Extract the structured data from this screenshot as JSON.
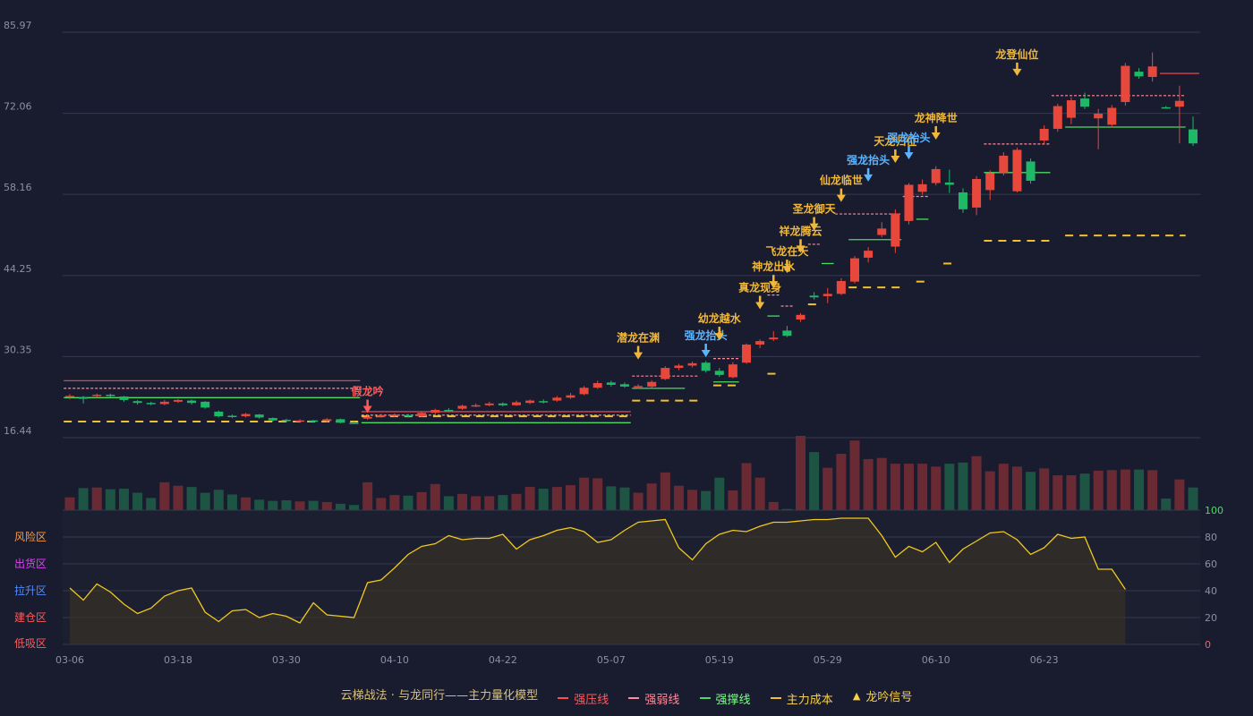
{
  "chart_data": {
    "type": "candlestick",
    "price_axis": {
      "ticks": [
        "85.97",
        "72.06",
        "58.16",
        "44.25",
        "30.35",
        "16.44"
      ],
      "min": 16.44,
      "max": 85.97
    },
    "x_tick_labels": [
      {
        "i": 0,
        "label": "03-06"
      },
      {
        "i": 8,
        "label": "03-18"
      },
      {
        "i": 16,
        "label": "03-30"
      },
      {
        "i": 24,
        "label": "04-10"
      },
      {
        "i": 32,
        "label": "04-22"
      },
      {
        "i": 40,
        "label": "05-07"
      },
      {
        "i": 48,
        "label": "05-19"
      },
      {
        "i": 56,
        "label": "05-29"
      },
      {
        "i": 64,
        "label": "06-10"
      },
      {
        "i": 72,
        "label": "06-23"
      }
    ],
    "candles": [
      [
        23.5,
        23.6,
        23.9,
        23.0
      ],
      [
        23.4,
        23.1,
        23.6,
        22.3
      ],
      [
        23.6,
        23.8,
        24.0,
        23.3
      ],
      [
        23.8,
        23.6,
        24.0,
        23.4
      ],
      [
        23.5,
        22.9,
        23.6,
        22.6
      ],
      [
        22.7,
        22.4,
        22.9,
        22.1
      ],
      [
        22.4,
        22.3,
        22.6,
        22.0
      ],
      [
        22.2,
        22.6,
        22.9,
        22.0
      ],
      [
        22.6,
        22.9,
        23.1,
        22.4
      ],
      [
        22.8,
        22.4,
        23.0,
        22.1
      ],
      [
        22.6,
        21.6,
        22.7,
        21.4
      ],
      [
        20.9,
        20.1,
        21.1,
        19.9
      ],
      [
        20.2,
        20.1,
        20.4,
        19.8
      ],
      [
        20.1,
        20.5,
        20.7,
        19.9
      ],
      [
        20.4,
        19.9,
        20.5,
        19.7
      ],
      [
        19.8,
        19.4,
        19.9,
        19.2
      ],
      [
        19.5,
        19.3,
        19.7,
        19.1
      ],
      [
        19.2,
        19.4,
        19.6,
        19.0
      ],
      [
        19.4,
        19.2,
        19.5,
        19.0
      ],
      [
        19.3,
        19.6,
        19.8,
        19.1
      ],
      [
        19.6,
        19.0,
        19.7,
        18.9
      ],
      [
        19.0,
        18.9,
        19.2,
        18.8
      ],
      [
        19.7,
        20.0,
        20.3,
        19.5
      ],
      [
        20.0,
        20.3,
        20.5,
        19.9
      ],
      [
        20.2,
        20.4,
        20.6,
        20.0
      ],
      [
        20.3,
        20.1,
        20.5,
        19.9
      ],
      [
        20.1,
        20.7,
        20.9,
        20.0
      ],
      [
        20.7,
        21.2,
        21.4,
        20.5
      ],
      [
        21.2,
        21.0,
        21.5,
        20.8
      ],
      [
        21.4,
        21.9,
        22.1,
        21.2
      ],
      [
        21.9,
        22.0,
        22.3,
        21.7
      ],
      [
        22.0,
        22.3,
        22.6,
        21.8
      ],
      [
        22.3,
        22.0,
        22.5,
        21.8
      ],
      [
        22.0,
        22.5,
        22.8,
        21.9
      ],
      [
        22.4,
        22.8,
        23.0,
        22.2
      ],
      [
        22.7,
        22.5,
        23.0,
        22.3
      ],
      [
        22.8,
        23.3,
        23.6,
        22.6
      ],
      [
        23.3,
        23.7,
        24.1,
        23.1
      ],
      [
        23.9,
        25.0,
        25.3,
        23.7
      ],
      [
        25.0,
        25.8,
        26.2,
        24.8
      ],
      [
        25.9,
        25.5,
        26.2,
        25.2
      ],
      [
        25.6,
        25.2,
        25.9,
        25.0
      ],
      [
        25.1,
        25.3,
        25.6,
        24.8
      ],
      [
        25.2,
        26.0,
        26.3,
        25.0
      ],
      [
        26.5,
        28.4,
        28.7,
        26.3
      ],
      [
        28.4,
        28.8,
        29.1,
        28.0
      ],
      [
        28.8,
        29.2,
        29.5,
        28.5
      ],
      [
        29.3,
        27.9,
        29.6,
        27.6
      ],
      [
        27.9,
        27.2,
        28.4,
        26.9
      ],
      [
        26.8,
        29.0,
        29.4,
        26.6
      ],
      [
        29.3,
        32.4,
        32.6,
        29.1
      ],
      [
        32.4,
        33.0,
        33.3,
        31.8
      ],
      [
        33.3,
        33.6,
        34.7,
        33.0
      ],
      [
        34.8,
        33.9,
        35.6,
        33.7
      ],
      [
        36.7,
        37.5,
        37.8,
        36.3
      ],
      [
        40.8,
        40.5,
        41.4,
        40.1
      ],
      [
        40.7,
        41.1,
        42.1,
        39.5
      ],
      [
        41.1,
        43.3,
        43.8,
        40.9
      ],
      [
        43.2,
        47.2,
        47.6,
        42.9
      ],
      [
        47.3,
        48.5,
        49.1,
        46.5
      ],
      [
        51.2,
        52.3,
        53.4,
        50.8
      ],
      [
        49.2,
        54.9,
        55.6,
        48.1
      ],
      [
        53.6,
        59.8,
        60.1,
        53.0
      ],
      [
        58.6,
        59.9,
        60.7,
        58.1
      ],
      [
        60.1,
        62.5,
        63.0,
        59.7
      ],
      [
        60.2,
        59.8,
        62.4,
        58.4
      ],
      [
        58.5,
        55.6,
        59.2,
        55.0
      ],
      [
        55.9,
        60.8,
        61.3,
        54.6
      ],
      [
        58.9,
        61.8,
        62.3,
        57.2
      ],
      [
        61.9,
        64.8,
        65.4,
        61.4
      ],
      [
        58.7,
        65.8,
        66.2,
        58.5
      ],
      [
        63.8,
        60.5,
        64.3,
        60.0
      ],
      [
        67.4,
        69.4,
        70.0,
        66.8
      ],
      [
        69.4,
        73.3,
        73.7,
        68.9
      ],
      [
        71.3,
        74.3,
        74.8,
        70.2
      ],
      [
        74.6,
        73.2,
        75.6,
        72.8
      ],
      [
        71.2,
        72.0,
        72.8,
        65.9
      ],
      [
        70.1,
        73.0,
        73.5,
        69.6
      ],
      [
        74.0,
        80.2,
        80.7,
        73.4
      ],
      [
        79.2,
        78.4,
        79.8,
        78.0
      ],
      [
        78.3,
        80.1,
        82.5,
        77.5
      ],
      [
        73.1,
        73.0,
        73.3,
        72.9
      ],
      [
        73.2,
        74.2,
        76.8,
        66.9
      ],
      [
        69.3,
        66.9,
        71.5,
        66.5
      ]
    ],
    "volume": [
      22,
      38,
      39,
      36,
      37,
      30,
      21,
      48,
      42,
      40,
      30,
      35,
      27,
      22,
      18,
      16,
      17,
      15,
      16,
      14,
      11,
      9,
      48,
      21,
      26,
      25,
      31,
      45,
      24,
      28,
      24,
      24,
      26,
      28,
      40,
      37,
      40,
      43,
      56,
      55,
      41,
      39,
      30,
      46,
      65,
      42,
      35,
      33,
      56,
      34,
      81,
      56,
      14,
      2,
      128,
      100,
      73,
      97,
      120,
      88,
      90,
      80,
      80,
      80,
      75,
      80,
      82,
      93,
      67,
      80,
      75,
      66,
      72,
      60,
      60,
      63,
      68,
      69,
      70,
      70,
      69,
      20,
      53,
      39
    ],
    "resistance_segments": [
      {
        "from": 0,
        "to": 21,
        "price": 26.2
      },
      {
        "from": 22,
        "to": 41,
        "price": 20.9
      },
      {
        "from": 81,
        "to": 83,
        "price": 78.9
      }
    ],
    "weak_segments": [
      {
        "from": 0,
        "to": 21,
        "price": 24.9
      },
      {
        "from": 22,
        "to": 41,
        "price": 20.3
      },
      {
        "from": 42,
        "to": 46,
        "price": 27.0
      },
      {
        "from": 48,
        "to": 49,
        "price": 30.0
      },
      {
        "from": 52,
        "to": 52,
        "price": 40.9
      },
      {
        "from": 53,
        "to": 53,
        "price": 39.0
      },
      {
        "from": 55,
        "to": 55,
        "price": 49.6
      },
      {
        "from": 57,
        "to": 61,
        "price": 54.8
      },
      {
        "from": 62,
        "to": 63,
        "price": 57.8
      },
      {
        "from": 68,
        "to": 72,
        "price": 66.8
      },
      {
        "from": 73,
        "to": 82,
        "price": 75.1
      }
    ],
    "support_segments": [
      {
        "from": 0,
        "to": 21,
        "price": 23.3
      },
      {
        "from": 22,
        "to": 41,
        "price": 19.0
      },
      {
        "from": 42,
        "to": 45,
        "price": 24.9
      },
      {
        "from": 48,
        "to": 49,
        "price": 26.0
      },
      {
        "from": 52,
        "to": 52,
        "price": 37.3
      },
      {
        "from": 56,
        "to": 56,
        "price": 46.3
      },
      {
        "from": 58,
        "to": 61,
        "price": 50.4
      },
      {
        "from": 63,
        "to": 63,
        "price": 53.9
      },
      {
        "from": 68,
        "to": 72,
        "price": 61.9
      },
      {
        "from": 74,
        "to": 82,
        "price": 69.7
      }
    ],
    "cost_segments": [
      {
        "from": 0,
        "to": 21,
        "price": 19.2
      },
      {
        "from": 22,
        "to": 41,
        "price": 20.1
      },
      {
        "from": 42,
        "to": 46,
        "price": 22.8
      },
      {
        "from": 48,
        "to": 49,
        "price": 25.4
      },
      {
        "from": 52,
        "to": 52,
        "price": 27.4
      },
      {
        "from": 55,
        "to": 55,
        "price": 39.3
      },
      {
        "from": 58,
        "to": 61,
        "price": 42.2
      },
      {
        "from": 63,
        "to": 63,
        "price": 43.2
      },
      {
        "from": 65,
        "to": 65,
        "price": 46.3
      },
      {
        "from": 68,
        "to": 72,
        "price": 50.2
      },
      {
        "from": 74,
        "to": 82,
        "price": 51.1
      }
    ],
    "signals": [
      {
        "i": 22,
        "label": "假龙吟",
        "color": "#ff5a5a",
        "price": 20.2
      },
      {
        "i": 42,
        "label": "潜龙在渊",
        "color": "#f0b83a",
        "price": 29.4
      },
      {
        "i": 47,
        "label": "强龙抬头",
        "color": "#5ab4ff",
        "price": 29.8
      },
      {
        "i": 48,
        "label": "幼龙越水",
        "color": "#f0b83a",
        "price": 32.7
      },
      {
        "i": 51,
        "label": "真龙现身",
        "color": "#f0b83a",
        "price": 38.0
      },
      {
        "i": 52,
        "label": "神龙出水",
        "color": "#f0b83a",
        "price": 41.6
      },
      {
        "i": 53,
        "label": "飞龙在天",
        "color": "#f0b83a",
        "price": 44.2
      },
      {
        "i": 54,
        "label": "祥龙腾云",
        "color": "#f0b83a",
        "price": 47.7
      },
      {
        "i": 55,
        "label": "圣龙御天",
        "color": "#f0b83a",
        "price": 51.5
      },
      {
        "i": 57,
        "label": "仙龙临世",
        "color": "#f0b83a",
        "price": 56.4
      },
      {
        "i": 59,
        "label": "强龙抬头",
        "color": "#5ab4ff",
        "price": 59.9
      },
      {
        "i": 61,
        "label": "天龙归位",
        "color": "#f0b83a",
        "price": 63.1
      },
      {
        "i": 62,
        "label": "强龙抬头",
        "color": "#5ab4ff",
        "price": 63.7
      },
      {
        "i": 64,
        "label": "龙神降世",
        "color": "#f0b83a",
        "price": 67.1
      },
      {
        "i": 70,
        "label": "龙登仙位",
        "color": "#f0b83a",
        "price": 78.0
      }
    ],
    "oscillator": {
      "axis_ticks": [
        "100",
        "80",
        "60",
        "40",
        "20",
        "0"
      ],
      "zones": [
        {
          "label": "风险区",
          "color": "#ff9a3c"
        },
        {
          "label": "出货区",
          "color": "#e040fb"
        },
        {
          "label": "拉升区",
          "color": "#4f8cff"
        },
        {
          "label": "建仓区",
          "color": "#ff5a5a"
        },
        {
          "label": "低吸区",
          "color": "#ff5a5a"
        }
      ],
      "values": [
        42,
        33,
        45,
        39,
        30,
        23,
        27,
        36,
        40,
        42,
        24,
        17,
        25,
        26,
        20,
        23,
        21,
        16,
        31,
        22,
        21,
        20,
        46,
        48,
        57,
        67,
        73,
        75,
        81,
        78,
        79,
        79,
        82,
        71,
        78,
        81,
        85,
        87,
        84,
        76,
        78,
        85,
        91,
        92,
        93,
        72,
        63,
        75,
        82,
        85,
        84,
        88,
        91,
        91,
        92,
        93,
        93,
        94,
        94,
        94,
        81,
        65,
        73,
        69,
        76,
        61,
        71,
        77,
        83,
        84,
        78,
        67,
        72,
        82,
        79,
        80,
        56,
        56,
        41
      ]
    },
    "legend": {
      "title": "云梯战法 · 与龙同行——主力量化模型",
      "resistance": "强压线",
      "weak": "强弱线",
      "support": "强撑线",
      "cost": "主力成本",
      "signal": "龙吟信号"
    },
    "colors": {
      "background": "#191c2e",
      "up": "#e8473c",
      "down": "#1fb866",
      "volume_up": "#6a2a34",
      "volume_down": "#1d5444",
      "resistance": "#d9434f",
      "weak": "#ff8a9a",
      "support": "#4cd964",
      "cost": "#f0c030",
      "oscillator_line": "#f0c81e",
      "grid": "#363a4e"
    }
  }
}
